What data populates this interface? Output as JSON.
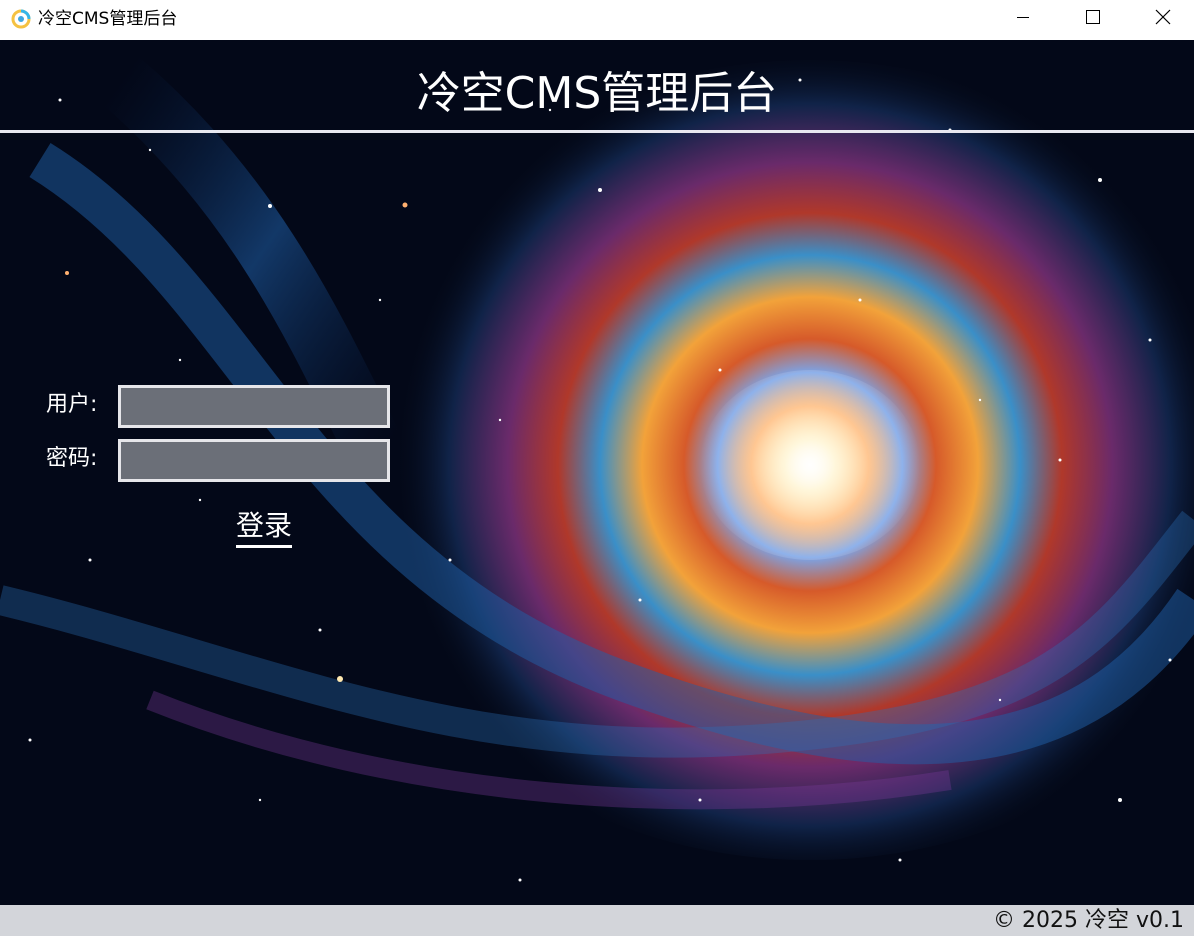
{
  "window": {
    "title": "冷空CMS管理后台",
    "icon": "app-swirl-icon",
    "controls": [
      "minimize-icon",
      "maximize-icon",
      "close-icon"
    ]
  },
  "header": {
    "title": "冷空CMS管理后台"
  },
  "form": {
    "user_label": "用户:",
    "user_value": "",
    "password_label": "密码:",
    "password_value": "",
    "login_label": "登录"
  },
  "footer": {
    "copyright": "© 2025 冷空 v0.1"
  },
  "colors": {
    "input_bg": "#6b6f78",
    "input_border": "#e6e6ea",
    "statusbar_bg": "#d3d5da"
  }
}
